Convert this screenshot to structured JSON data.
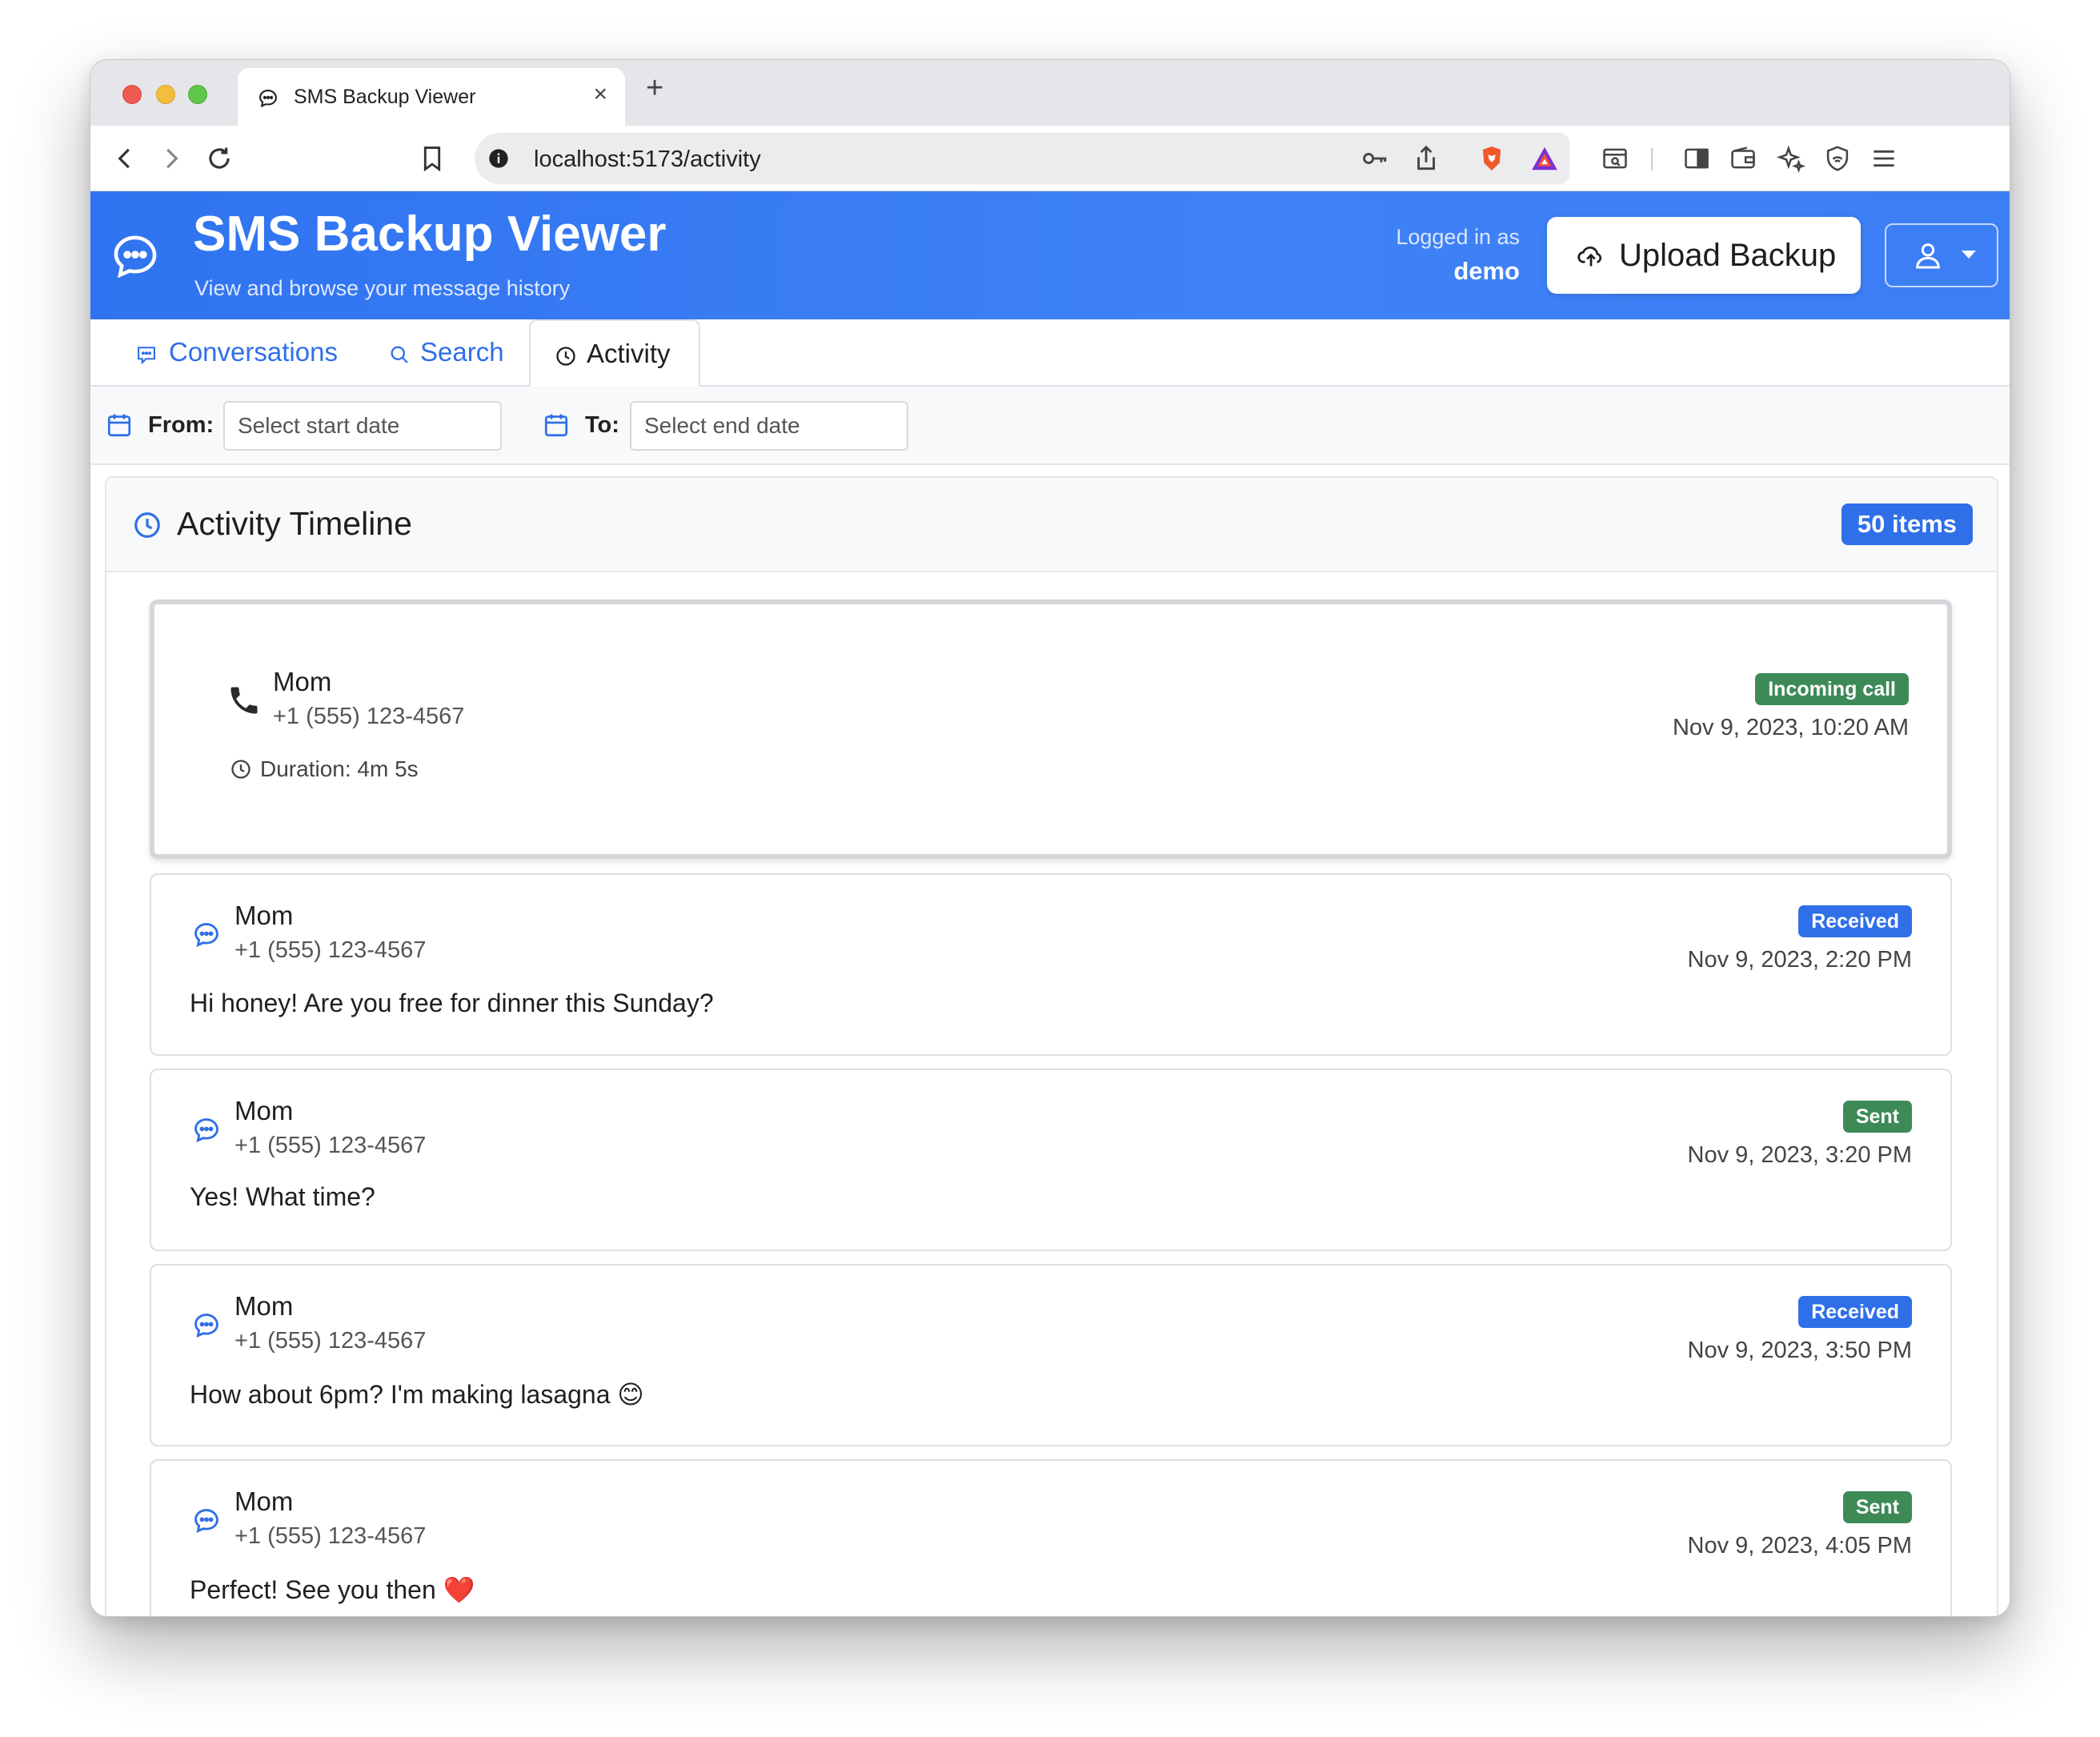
{
  "browser": {
    "tab_title": "SMS Backup Viewer",
    "tab_close": "×",
    "new_tab": "+",
    "url": "localhost:5173/activity"
  },
  "header": {
    "title": "SMS Backup Viewer",
    "subtitle": "View and browse your message history",
    "logged_in_label": "Logged in as",
    "username": "demo",
    "upload_label": "Upload Backup",
    "brand_color": "#3b7ef5"
  },
  "nav": {
    "conversations": "Conversations",
    "search": "Search",
    "activity": "Activity"
  },
  "filters": {
    "from_label": "From:",
    "from_placeholder": "Select start date",
    "to_label": "To:",
    "to_placeholder": "Select end date"
  },
  "timeline": {
    "title": "Activity Timeline",
    "count_badge": "50 items",
    "entries": [
      {
        "type": "call",
        "name": "Mom",
        "phone": "+1 (555) 123-4567",
        "duration": "Duration: 4m 5s",
        "badge": "Incoming call",
        "timestamp": "Nov 9, 2023, 10:20 AM"
      },
      {
        "type": "sms",
        "name": "Mom",
        "phone": "+1 (555) 123-4567",
        "body": "Hi honey! Are you free for dinner this Sunday?",
        "badge": "Received",
        "timestamp": "Nov 9, 2023, 2:20 PM"
      },
      {
        "type": "sms",
        "name": "Mom",
        "phone": "+1 (555) 123-4567",
        "body": "Yes! What time?",
        "badge": "Sent",
        "timestamp": "Nov 9, 2023, 3:20 PM"
      },
      {
        "type": "sms",
        "name": "Mom",
        "phone": "+1 (555) 123-4567",
        "body": "How about 6pm? I'm making lasagna 😊",
        "badge": "Received",
        "timestamp": "Nov 9, 2023, 3:50 PM"
      },
      {
        "type": "sms",
        "name": "Mom",
        "phone": "+1 (555) 123-4567",
        "body": "Perfect! See you then ❤️",
        "badge": "Sent",
        "timestamp": "Nov 9, 2023, 4:05 PM"
      }
    ]
  },
  "icons": {
    "tab_favicon": "chat-bubble-icon",
    "back": "chevron-left-icon",
    "forward": "chevron-right-icon",
    "reload": "reload-icon",
    "bookmark": "bookmark-icon",
    "site_info": "info-icon",
    "password": "key-icon",
    "share": "share-icon",
    "brave": "brave-shield-icon",
    "rewards": "triangle-icon",
    "reader": "reader-icon",
    "sidebar": "sidebar-icon",
    "wallet": "wallet-icon",
    "leo": "sparkle-icon",
    "vpn": "vpn-shield-icon",
    "menu": "hamburger-icon",
    "logo": "chat-bubble-icon",
    "upload": "cloud-upload-icon",
    "user": "user-icon",
    "calendar": "calendar-icon",
    "clock": "clock-icon",
    "phone": "phone-icon"
  }
}
